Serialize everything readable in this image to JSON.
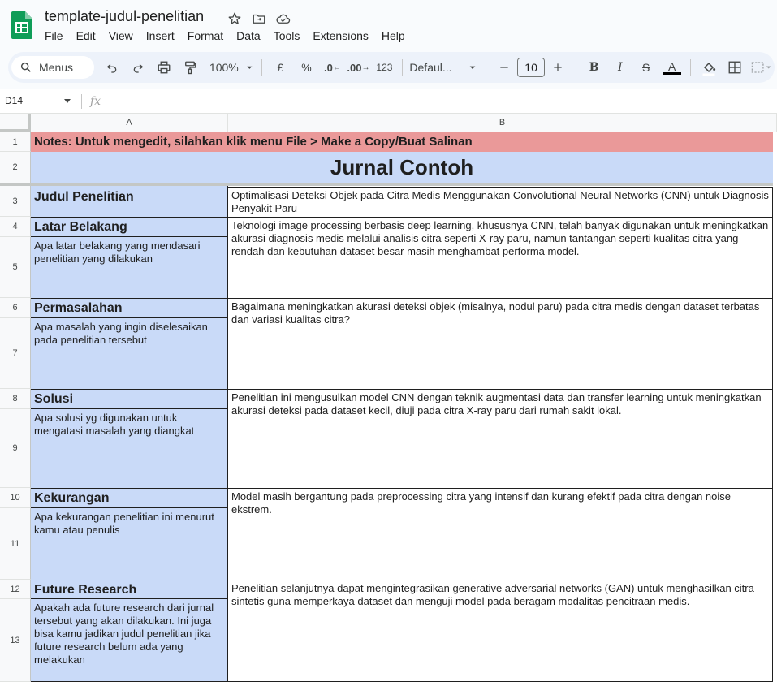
{
  "app": {
    "doc_title": "template-judul-penelitian",
    "menu": [
      "File",
      "Edit",
      "View",
      "Insert",
      "Format",
      "Data",
      "Tools",
      "Extensions",
      "Help"
    ]
  },
  "toolbar": {
    "search_placeholder": "Menus",
    "zoom": "100%",
    "currency": "£",
    "percent": "%",
    "dec_decrease": ".0",
    "dec_increase": ".00",
    "number_format": "123",
    "font_name": "Defaul...",
    "font_size": "10",
    "bold": "B",
    "italic": "I",
    "strike": "S",
    "text_color": "A"
  },
  "formula_bar": {
    "name_box": "D14",
    "fx": "fx"
  },
  "grid": {
    "columns": [
      "A",
      "B"
    ],
    "rows": [
      "1",
      "2",
      "3",
      "4",
      "5",
      "6",
      "7",
      "8",
      "9",
      "10",
      "11",
      "12",
      "13"
    ],
    "notes": "Notes: Untuk mengedit, silahkan klik menu File > Make a Copy/Buat Salinan",
    "title": "Jurnal Contoh",
    "sections": [
      {
        "heading": "Judul Penelitian",
        "description": "",
        "content": "Optimalisasi Deteksi Objek pada Citra Medis Menggunakan Convolutional Neural Networks (CNN) untuk Diagnosis Penyakit Paru"
      },
      {
        "heading": "Latar Belakang",
        "description": "Apa latar belakang yang mendasari penelitian yang dilakukan",
        "content": "Teknologi image processing berbasis deep learning, khususnya CNN, telah banyak digunakan untuk meningkatkan akurasi diagnosis medis melalui analisis citra seperti X-ray paru, namun tantangan seperti kualitas citra yang rendah dan kebutuhan dataset besar masih menghambat performa model."
      },
      {
        "heading": "Permasalahan",
        "description": "Apa masalah yang ingin diselesaikan pada penelitian tersebut",
        "content": "Bagaimana meningkatkan akurasi deteksi objek (misalnya, nodul paru) pada citra medis dengan dataset terbatas dan variasi kualitas citra?"
      },
      {
        "heading": "Solusi",
        "description": "Apa solusi yg digunakan untuk mengatasi masalah yang diangkat",
        "content": "Penelitian ini mengusulkan model CNN dengan teknik augmentasi data dan transfer learning untuk meningkatkan akurasi deteksi pada dataset kecil, diuji pada citra X-ray paru dari rumah sakit lokal."
      },
      {
        "heading": "Kekurangan",
        "description": "Apa kekurangan penelitian ini menurut kamu atau penulis",
        "content": "Model masih bergantung pada preprocessing citra yang intensif dan kurang efektif pada citra dengan noise ekstrem."
      },
      {
        "heading": "Future Research",
        "description": "Apakah ada future research dari jurnal tersebut yang akan dilakukan. Ini juga bisa kamu jadikan judul penelitian jika future research belum ada yang melakukan",
        "content": "Penelitian selanjutnya dapat mengintegrasikan generative adversarial networks (GAN) untuk menghasilkan citra sintetis guna memperkaya dataset dan menguji model pada beragam modalitas pencitraan medis."
      }
    ]
  },
  "colors": {
    "notes_bg": "#ea9999",
    "label_bg": "#c9daf8",
    "logo_green": "#0f9d58"
  }
}
